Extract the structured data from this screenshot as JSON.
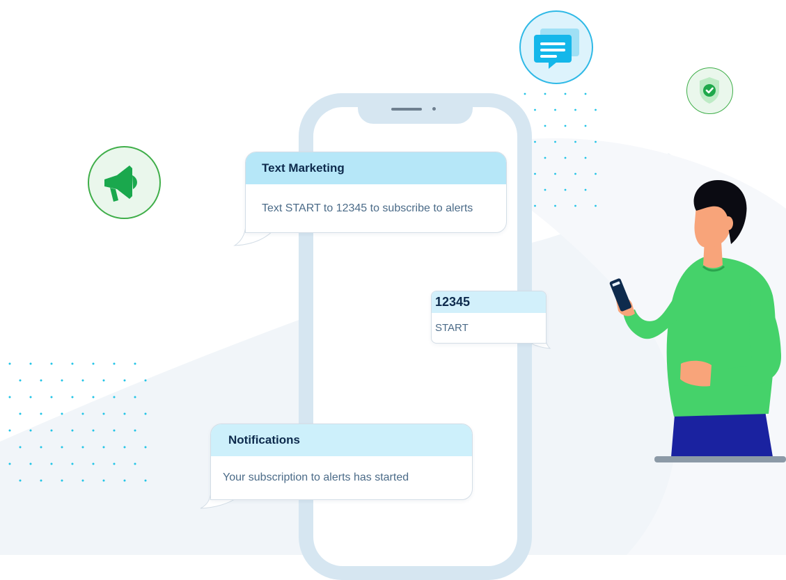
{
  "colors": {
    "accent_green": "#43d16b",
    "accent_blue": "#2fb9e6",
    "phone_frame": "#d6e6f1",
    "bubble_header": "#b6e7f8",
    "dark_navy": "#0e2b4d"
  },
  "icons": {
    "megaphone": "megaphone-icon",
    "chat": "chat-icon",
    "shield": "shield-check-icon"
  },
  "messages": {
    "marketing": {
      "title": "Text Marketing",
      "body": "Text START to 12345 to subscribe to alerts"
    },
    "reply": {
      "number": "12345",
      "body": "START"
    },
    "notification": {
      "title": "Notifications",
      "body": "Your subscription to alerts has started"
    }
  }
}
